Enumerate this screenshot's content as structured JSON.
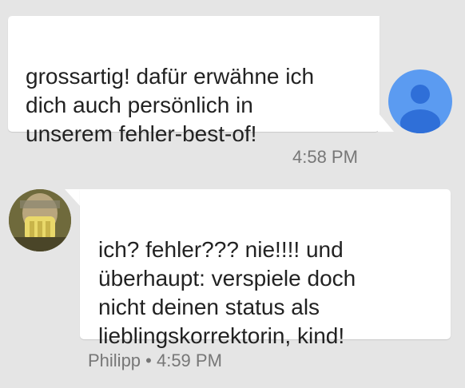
{
  "conversation": {
    "messages": [
      {
        "direction": "outgoing",
        "text": "grossartig! dafür erwähne ich\ndich auch persönlich in\nunserem fehler-best-of!",
        "time": "4:58 PM"
      },
      {
        "direction": "incoming",
        "text": "ich? fehler??? nie!!!! und\nüberhaupt: verspiele doch\nnicht deinen status als\nlieblingskorrektorin, kind!",
        "meta": "Philipp • 4:59 PM"
      }
    ]
  },
  "colors": {
    "background": "#e5e5e5",
    "bubble": "#ffffff",
    "avatar_default": "#5b9bf1",
    "avatar_silhouette": "#2f6fd8",
    "meta_text": "#777777"
  },
  "icons": {
    "user_avatar": "default-person-icon",
    "contact_avatar": "profile-photo"
  }
}
